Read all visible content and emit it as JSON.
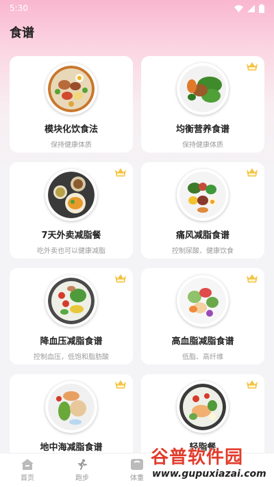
{
  "status_bar": {
    "time": "5:30"
  },
  "header": {
    "title": "食谱"
  },
  "cards": [
    {
      "title": "模块化饮食法",
      "subtitle": "保持健康体质",
      "vip": false
    },
    {
      "title": "均衡营养食谱",
      "subtitle": "保持健康体质",
      "vip": true
    },
    {
      "title": "7天外卖减脂餐",
      "subtitle": "吃外卖也可以健康减脂",
      "vip": true
    },
    {
      "title": "痛风减脂食谱",
      "subtitle": "控制尿酸、健康饮食",
      "vip": true
    },
    {
      "title": "降血压减脂食谱",
      "subtitle": "控制血压，低饱和脂肪酸",
      "vip": true
    },
    {
      "title": "高血脂减脂食谱",
      "subtitle": "低脂、高纤维",
      "vip": true
    },
    {
      "title": "地中海减脂食谱",
      "subtitle": "",
      "vip": true
    },
    {
      "title": "轻脂餐",
      "subtitle": "",
      "vip": true
    }
  ],
  "vip_badge": {
    "label": "VIP",
    "color": "#f5c342"
  },
  "tabbar": [
    {
      "label": "首页",
      "icon": "home-icon"
    },
    {
      "label": "跑步",
      "icon": "running-icon"
    },
    {
      "label": "体重",
      "icon": "scale-icon"
    },
    {
      "label": "",
      "icon": ""
    },
    {
      "label": "",
      "icon": ""
    }
  ],
  "watermark": {
    "brand": "谷普软件园",
    "url": "www.gupuxiazai.com"
  }
}
